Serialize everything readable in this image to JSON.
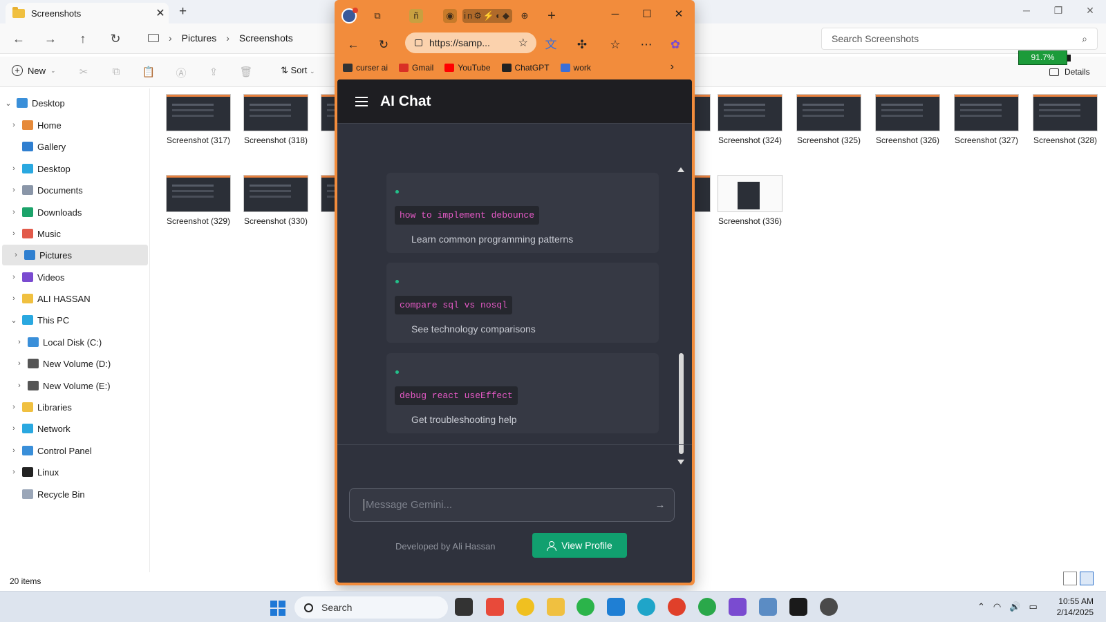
{
  "explorer": {
    "tab_title": "Screenshots",
    "breadcrumb": [
      "Pictures",
      "Screenshots"
    ],
    "search_placeholder": "Search Screenshots",
    "cmd": {
      "new_label": "New",
      "sort_label": "Sort",
      "details_label": "Details"
    },
    "battery_label": "91.7%",
    "sidebar": [
      {
        "label": "Desktop",
        "chev": "⌄",
        "color": "#3a8fd9"
      },
      {
        "label": "Home",
        "chev": "›",
        "color": "#e68a3a"
      },
      {
        "label": "Gallery",
        "chev": "",
        "color": "#2f7fd0"
      },
      {
        "label": "Desktop",
        "chev": "›",
        "color": "#2aa8e0"
      },
      {
        "label": "Documents",
        "chev": "›",
        "color": "#8a96a8"
      },
      {
        "label": "Downloads",
        "chev": "›",
        "color": "#1ca36a"
      },
      {
        "label": "Music",
        "chev": "›",
        "color": "#e25a4a"
      },
      {
        "label": "Pictures",
        "chev": "›",
        "color": "#2f7fd0"
      },
      {
        "label": "Videos",
        "chev": "›",
        "color": "#7a4bd0"
      },
      {
        "label": "ALI HASSAN",
        "chev": "›",
        "color": "#f0c040"
      },
      {
        "label": "This PC",
        "chev": "⌄",
        "color": "#2aa8e0"
      },
      {
        "label": "Local Disk (C:)",
        "chev": "›",
        "color": "#3a8fd9"
      },
      {
        "label": "New Volume (D:)",
        "chev": "›",
        "color": "#555555"
      },
      {
        "label": "New Volume (E:)",
        "chev": "›",
        "color": "#555555"
      },
      {
        "label": "Libraries",
        "chev": "›",
        "color": "#f0c040"
      },
      {
        "label": "Network",
        "chev": "›",
        "color": "#2aa8e0"
      },
      {
        "label": "Control Panel",
        "chev": "›",
        "color": "#3a8fd9"
      },
      {
        "label": "Linux",
        "chev": "›",
        "color": "#222222"
      },
      {
        "label": "Recycle Bin",
        "chev": "",
        "color": "#9aa6b8"
      }
    ],
    "files_row1": [
      "Screenshot (317)",
      "Screenshot (318)",
      "Sc",
      "3)",
      "Screenshot (324)",
      "Screenshot (325)",
      "Screenshot (326)",
      "Screenshot (327)",
      "Screenshot (328)"
    ],
    "files_row2": [
      "Screenshot (329)",
      "Screenshot (330)",
      "Sc",
      "5)",
      "Screenshot (336)"
    ],
    "status_items": "20 items"
  },
  "browser": {
    "url": "https://samp...",
    "bookmarks": [
      {
        "label": "curser ai",
        "color": "#333333"
      },
      {
        "label": "Gmail",
        "color": "#d93025"
      },
      {
        "label": "YouTube",
        "color": "#ff0000"
      },
      {
        "label": "ChatGPT",
        "color": "#222222"
      },
      {
        "label": "work",
        "color": "#3b6fd8"
      }
    ]
  },
  "app": {
    "title": "AI Chat",
    "cards": [
      {
        "code": "how to implement debounce",
        "desc": "Learn common programming patterns"
      },
      {
        "code": "compare sql vs nosql",
        "desc": "See technology comparisons"
      },
      {
        "code": "debug react useEffect",
        "desc": "Get troubleshooting help"
      }
    ],
    "input_placeholder": "Message Gemini...",
    "footer_text": "Developed by Ali Hassan",
    "profile_button": "View Profile"
  },
  "taskbar": {
    "search_label": "Search",
    "time": "10:55 AM",
    "date": "2/14/2025"
  }
}
